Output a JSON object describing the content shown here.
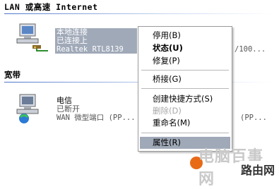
{
  "groups": {
    "lan_header": "LAN 或高速 Internet",
    "broadband_header": "宽带"
  },
  "lan_connection": {
    "name": "本地连接",
    "status": "已连接上",
    "device": "Realtek RTL8139",
    "right_fragment": "/100..."
  },
  "wan_connection": {
    "name": "电信",
    "status": "已断开",
    "device": "WAN 微型端口 (PP...",
    "right_fragment": "(PP..."
  },
  "context_menu": {
    "items": [
      {
        "label": "停用(B)",
        "bold": false,
        "disabled": false
      },
      {
        "label": "状态(U)",
        "bold": true,
        "disabled": false
      },
      {
        "label": "修复(P)",
        "bold": false,
        "disabled": false
      },
      {
        "label": "桥接(G)",
        "bold": false,
        "disabled": false
      },
      {
        "label": "创建快捷方式(S)",
        "bold": false,
        "disabled": false
      },
      {
        "label": "删除(D)",
        "bold": false,
        "disabled": true
      },
      {
        "label": "重命名(M)",
        "bold": false,
        "disabled": false
      },
      {
        "label": "属性(R)",
        "bold": false,
        "disabled": false,
        "selected": true
      }
    ]
  },
  "watermark": {
    "line1": "电脑百事网",
    "line2": "路由网"
  },
  "colors": {
    "selection": "#a0a9b8",
    "header_line": "#4a74c8"
  }
}
